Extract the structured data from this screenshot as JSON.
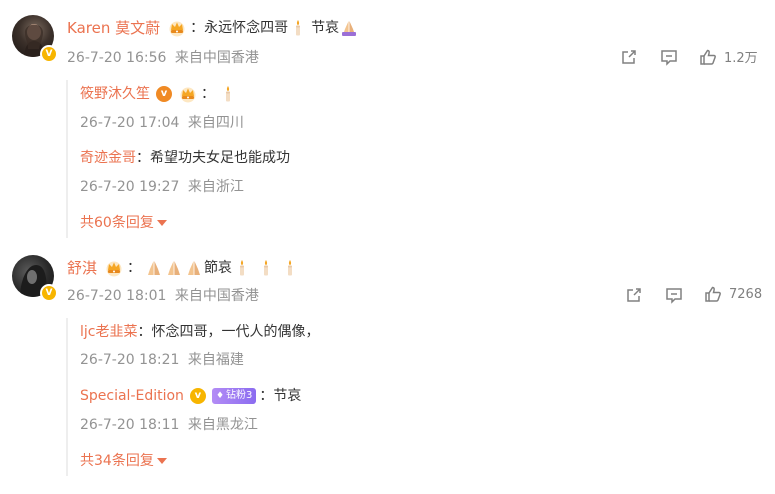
{
  "comments": [
    {
      "user": "Karen 莫文蔚",
      "separator": "：",
      "text_parts": [
        "永远怀念四哥",
        "节哀"
      ],
      "time": "26-7-20 16:56",
      "location": "来自中国香港",
      "like_count": "1.2万",
      "replies": [
        {
          "user": "筱野沐久笙",
          "separator": "：",
          "text": "",
          "time": "26-7-20 17:04",
          "location": "来自四川"
        },
        {
          "user": "奇迹金哥",
          "separator": "：",
          "text": "希望功夫女足也能成功",
          "time": "26-7-20 19:27",
          "location": "来自浙江"
        }
      ],
      "more_replies": "共60条回复"
    },
    {
      "user": "舒淇",
      "separator": "：",
      "text_parts": [
        "節哀"
      ],
      "time": "26-7-20 18:01",
      "location": "来自中国香港",
      "like_count": "7268",
      "replies": [
        {
          "user": "ljc老韭菜",
          "separator": "：",
          "text": "怀念四哥，一代人的偶像，",
          "time": "26-7-20 18:21",
          "location": "来自福建"
        },
        {
          "user": "Special-Edition",
          "badge": "钻粉3",
          "separator": "：",
          "text": "节哀",
          "time": "26-7-20 18:11",
          "location": "来自黑龙江"
        }
      ],
      "more_replies": "共34条回复"
    }
  ],
  "icons": {
    "verified": "verified-badge-icon",
    "crown": "crown-fan-icon",
    "candle": "candle-emoji",
    "pray": "pray-emoji",
    "share": "share-icon",
    "comment": "comment-icon",
    "like": "thumbs-up-icon"
  },
  "colors": {
    "username": "#eb7350",
    "meta": "#939393",
    "text": "#333333",
    "verified": "#f7b500"
  }
}
